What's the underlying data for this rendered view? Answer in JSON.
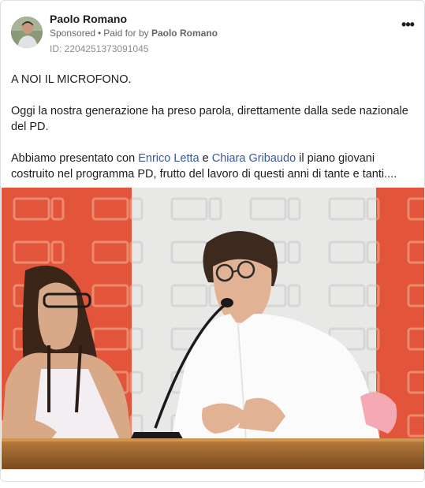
{
  "post": {
    "author": "Paolo Romano",
    "sponsored_label": "Sponsored",
    "dot": "•",
    "paid_for_prefix": "Paid for by",
    "payer": "Paolo Romano",
    "ad_id": "ID: 2204251373091045",
    "more_icon": "•••",
    "text": {
      "line1": "A NOI IL MICROFONO.",
      "para2": "Oggi la nostra generazione ha preso parola, direttamente dalla sede nazionale del PD.",
      "para3_start": "Abbiamo presentato con ",
      "mention1": "Enrico Letta",
      "para3_and": " e ",
      "mention2": "Chiara Gribaudo",
      "para3_end": " il piano giovani costruito nel programma PD, frutto del lavoro di questi anni di tante e tanti...."
    }
  },
  "colors": {
    "link": "#385898",
    "backdrop_orange": "#e2553a",
    "backdrop_white": "#eeeeee"
  }
}
